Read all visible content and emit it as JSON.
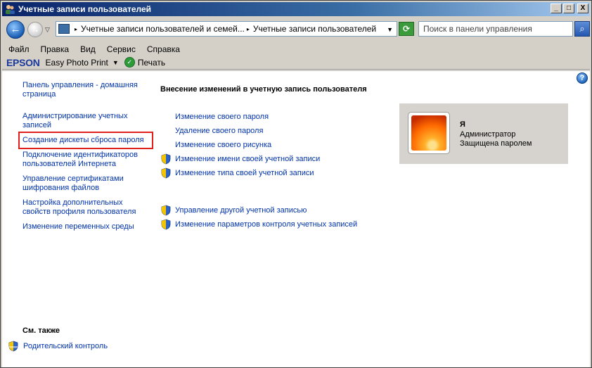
{
  "window": {
    "title": "Учетные записи пользователей",
    "buttons": {
      "minimize": "_",
      "maximize": "□",
      "close": "X"
    }
  },
  "address": {
    "breadcrumb": [
      "Учетные записи пользователей и семей...",
      "Учетные записи пользователей"
    ],
    "search_placeholder": "Поиск в панели управления"
  },
  "menu": [
    "Файл",
    "Правка",
    "Вид",
    "Сервис",
    "Справка"
  ],
  "toolbar": {
    "brand": "EPSON",
    "app": "Easy Photo Print",
    "print": "Печать"
  },
  "sidebar": {
    "items": [
      "Панель управления - домашняя страница",
      "Администрирование учетных записей",
      "Создание дискеты сброса пароля",
      "Подключение идентификаторов пользователей Интернета",
      "Управление сертификатами шифрования файлов",
      "Настройка дополнительных свойств профиля пользователя",
      "Изменение переменных среды"
    ],
    "see_also_title": "См. также",
    "see_also_link": "Родительский контроль"
  },
  "main": {
    "title": "Внесение изменений в учетную запись пользователя",
    "tasks": [
      {
        "label": "Изменение своего пароля",
        "shield": false
      },
      {
        "label": "Удаление своего пароля",
        "shield": false
      },
      {
        "label": "Изменение своего рисунка",
        "shield": false
      },
      {
        "label": "Изменение имени своей учетной записи",
        "shield": true
      },
      {
        "label": "Изменение типа своей учетной записи",
        "shield": true
      }
    ],
    "other_tasks": [
      {
        "label": "Управление другой учетной записью",
        "shield": true
      },
      {
        "label": "Изменение параметров контроля учетных записей",
        "shield": true
      }
    ]
  },
  "user": {
    "name": "Я",
    "role": "Администратор",
    "status": "Защищена паролем"
  },
  "colors": {
    "link": "#0033aa",
    "highlight": "#e0201a",
    "titlebar": "#0a246a",
    "card": "#d6d3ce"
  }
}
